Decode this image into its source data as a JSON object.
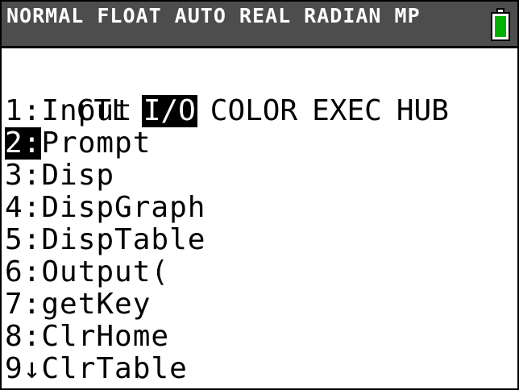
{
  "status_bar": {
    "text": "NORMAL FLOAT AUTO REAL RADIAN MP",
    "battery_color": "#00b000"
  },
  "menu": {
    "tabs": [
      {
        "label": "CTL",
        "selected": false
      },
      {
        "label": "I/O",
        "selected": true
      },
      {
        "label": "COLOR",
        "selected": false
      },
      {
        "label": "EXEC",
        "selected": false
      },
      {
        "label": "HUB",
        "selected": false
      }
    ],
    "items": [
      {
        "num": "1:",
        "label": "Input",
        "selected": false
      },
      {
        "num": "2:",
        "label": "Prompt",
        "selected": true
      },
      {
        "num": "3:",
        "label": "Disp",
        "selected": false
      },
      {
        "num": "4:",
        "label": "DispGraph",
        "selected": false
      },
      {
        "num": "5:",
        "label": "DispTable",
        "selected": false
      },
      {
        "num": "6:",
        "label": "Output(",
        "selected": false
      },
      {
        "num": "7:",
        "label": "getKey",
        "selected": false
      },
      {
        "num": "8:",
        "label": "ClrHome",
        "selected": false
      },
      {
        "num": "9↓",
        "label": "ClrTable",
        "selected": false
      }
    ]
  }
}
